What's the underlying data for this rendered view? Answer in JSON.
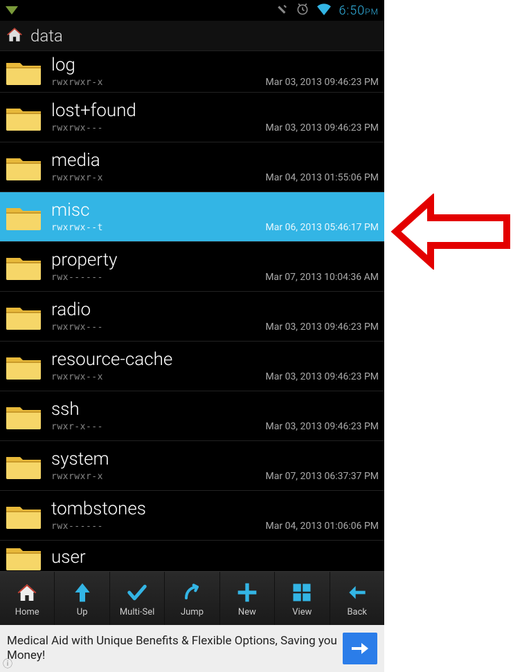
{
  "status": {
    "time": "6:50",
    "ampm": "PM"
  },
  "path": "data",
  "files": [
    {
      "name": "log",
      "perm": "rwxrwxr-x",
      "date": "Mar 03, 2013 09:46:23 PM",
      "selected": false,
      "truncated_top": true
    },
    {
      "name": "lost+found",
      "perm": "rwxrwx---",
      "date": "Mar 03, 2013 09:46:23 PM",
      "selected": false
    },
    {
      "name": "media",
      "perm": "rwxrwxr-x",
      "date": "Mar 04, 2013 01:55:06 PM",
      "selected": false
    },
    {
      "name": "misc",
      "perm": "rwxrwx--t",
      "date": "Mar 06, 2013 05:46:17 PM",
      "selected": true
    },
    {
      "name": "property",
      "perm": "rwx------",
      "date": "Mar 07, 2013 10:04:36 AM",
      "selected": false
    },
    {
      "name": "radio",
      "perm": "rwxrwx---",
      "date": "Mar 03, 2013 09:46:23 PM",
      "selected": false
    },
    {
      "name": "resource-cache",
      "perm": "rwxrwx--x",
      "date": "Mar 03, 2013 09:46:23 PM",
      "selected": false
    },
    {
      "name": "ssh",
      "perm": "rwxr-x---",
      "date": "Mar 03, 2013 09:46:23 PM",
      "selected": false
    },
    {
      "name": "system",
      "perm": "rwxrwxr-x",
      "date": "Mar 07, 2013 06:37:37 PM",
      "selected": false
    },
    {
      "name": "tombstones",
      "perm": "rwx------",
      "date": "Mar 04, 2013 01:06:06 PM",
      "selected": false
    },
    {
      "name": "user",
      "perm": "",
      "date": "",
      "selected": false,
      "truncated_bottom": true
    }
  ],
  "toolbar": [
    {
      "label": "Home",
      "icon": "home"
    },
    {
      "label": "Up",
      "icon": "up"
    },
    {
      "label": "Multi-Sel",
      "icon": "check"
    },
    {
      "label": "Jump",
      "icon": "jump"
    },
    {
      "label": "New",
      "icon": "plus"
    },
    {
      "label": "View",
      "icon": "grid"
    },
    {
      "label": "Back",
      "icon": "back"
    }
  ],
  "ad": {
    "text": "Medical Aid with Unique Benefits & Flexible Options, Saving you Money!"
  }
}
